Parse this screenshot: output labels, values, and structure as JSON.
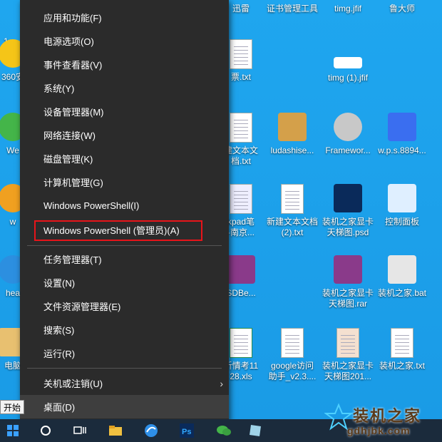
{
  "menu": {
    "items": [
      {
        "label": "应用和功能(F)"
      },
      {
        "label": "电源选项(O)"
      },
      {
        "label": "事件查看器(V)"
      },
      {
        "label": "系统(Y)"
      },
      {
        "label": "设备管理器(M)"
      },
      {
        "label": "网络连接(W)"
      },
      {
        "label": "磁盘管理(K)"
      },
      {
        "label": "计算机管理(G)"
      },
      {
        "label": "Windows PowerShell(I)"
      },
      {
        "label": "Windows PowerShell (管理员)(A)"
      },
      {
        "label": "任务管理器(T)"
      },
      {
        "label": "设置(N)"
      },
      {
        "label": "文件资源管理器(E)"
      },
      {
        "label": "搜索(S)"
      },
      {
        "label": "运行(R)"
      },
      {
        "label": "关机或注销(U)"
      },
      {
        "label": "桌面(D)"
      }
    ]
  },
  "tooltip": "开始",
  "watermark": {
    "title": "装机之家",
    "url": "gdhjbk.com"
  },
  "desktop_icons": {
    "c1": [
      "1.",
      "360安",
      "We",
      "w",
      "hea",
      "电脑"
    ],
    "c2": [
      "迅雷",
      "票.txt",
      "建文本文\n档.txt",
      "kpad笔\n-南京...",
      "SDBe...",
      "听情考11\n28.xls"
    ],
    "c3": [
      "证书管理工具",
      "ludashise...",
      "新建文本文档\n(2).txt",
      "google访问\n助手_v2.3...."
    ],
    "c4": [
      "timg.jfif",
      "timg (1).jfif",
      "Framewor...",
      "装机之家显卡\n天梯图.psd",
      "装机之家显卡\n天梯图.rar",
      "装机之家显卡\n天梯图201..."
    ],
    "c5": [
      "鲁大师",
      "w.p.s.8894...",
      "控制面板",
      "装机之家.bat",
      "装机之家.txt"
    ]
  }
}
